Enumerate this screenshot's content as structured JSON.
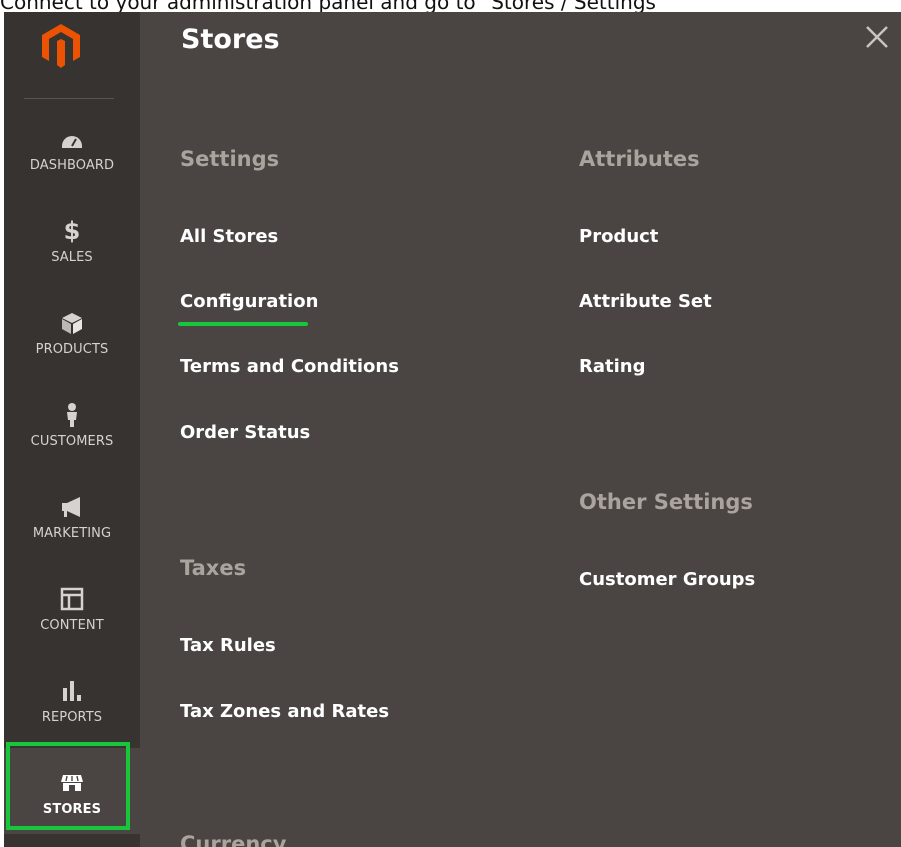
{
  "caption": {
    "text": "Connect to your administration panel and go to \"Stores / Settings"
  },
  "sidebar": {
    "logo": "magento-logo",
    "items": [
      {
        "label": "DASHBOARD",
        "icon": "dashboard-icon"
      },
      {
        "label": "SALES",
        "icon": "dollar-icon"
      },
      {
        "label": "PRODUCTS",
        "icon": "box-icon"
      },
      {
        "label": "CUSTOMERS",
        "icon": "person-icon"
      },
      {
        "label": "MARKETING",
        "icon": "megaphone-icon"
      },
      {
        "label": "CONTENT",
        "icon": "layout-icon"
      },
      {
        "label": "REPORTS",
        "icon": "bar-chart-icon"
      },
      {
        "label": "STORES",
        "icon": "storefront-icon",
        "active": true
      }
    ]
  },
  "panel": {
    "title": "Stores",
    "close_icon": "close-icon",
    "columns": [
      {
        "sections": [
          {
            "heading": "Settings",
            "links": [
              "All Stores",
              "Configuration",
              "Terms and Conditions",
              "Order Status"
            ]
          },
          {
            "heading": "Taxes",
            "links": [
              "Tax Rules",
              "Tax Zones and Rates"
            ]
          },
          {
            "heading": "Currency",
            "links": []
          }
        ]
      },
      {
        "sections": [
          {
            "heading": "Attributes",
            "links": [
              "Product",
              "Attribute Set",
              "Rating"
            ]
          },
          {
            "heading": "Other Settings",
            "links": [
              "Customer Groups"
            ]
          }
        ]
      }
    ]
  },
  "colors": {
    "panel_bg": "#4a4542",
    "sidebar_bg": "#373330",
    "logo_orange": "#eb5202",
    "highlight_green": "#17c63a",
    "heading_gray": "#aaa39e"
  }
}
